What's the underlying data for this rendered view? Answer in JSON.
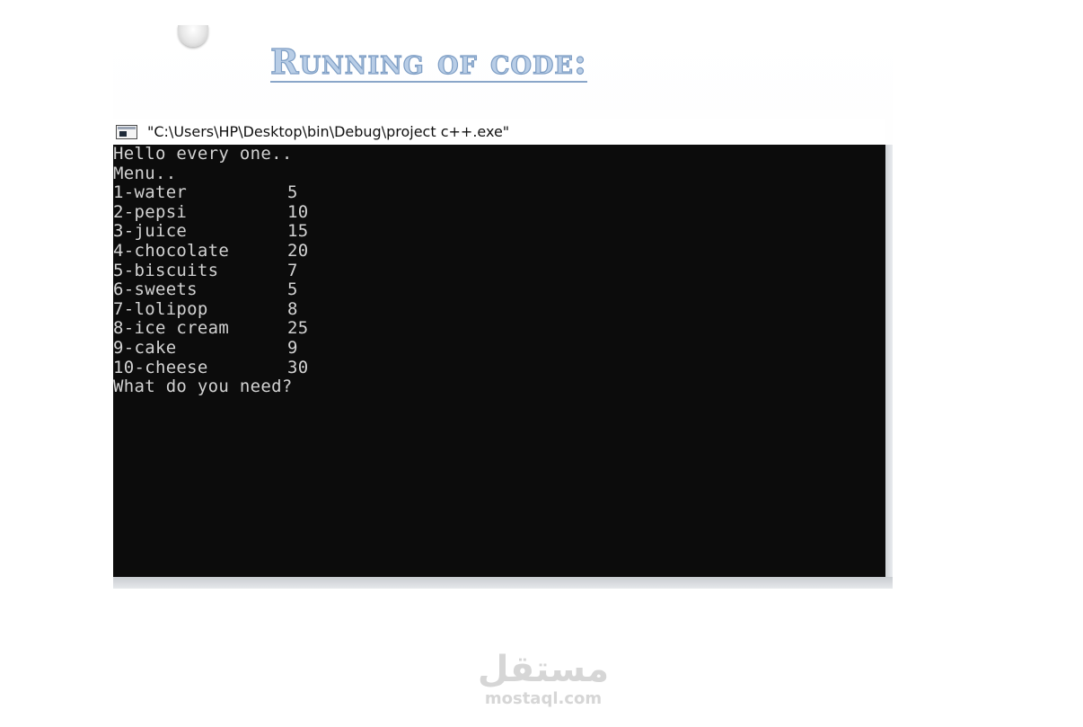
{
  "slide": {
    "title": "Running of code:"
  },
  "console": {
    "window_title": "\"C:\\Users\\HP\\Desktop\\bin\\Debug\\project c++.exe\"",
    "greeting": "Hello every one..",
    "menu_heading": "Menu..",
    "menu_items": [
      {
        "name": "1-water",
        "price": "5"
      },
      {
        "name": "2-pepsi",
        "price": "10"
      },
      {
        "name": "3-juice",
        "price": "15"
      },
      {
        "name": "4-chocolate",
        "price": "20"
      },
      {
        "name": "5-biscuits",
        "price": "7"
      },
      {
        "name": "6-sweets",
        "price": "5"
      },
      {
        "name": "7-lolipop",
        "price": "8"
      },
      {
        "name": "8-ice cream",
        "price": "25"
      },
      {
        "name": "9-cake",
        "price": "9"
      },
      {
        "name": "10-cheese",
        "price": "30"
      }
    ],
    "prompt": "What do you need?",
    "icon": "console-window-icon",
    "colors": {
      "background": "#0c0c0c",
      "text": "#d2d2d2"
    }
  },
  "watermark": {
    "arabic": "مستقل",
    "latin": "mostaql.com"
  }
}
